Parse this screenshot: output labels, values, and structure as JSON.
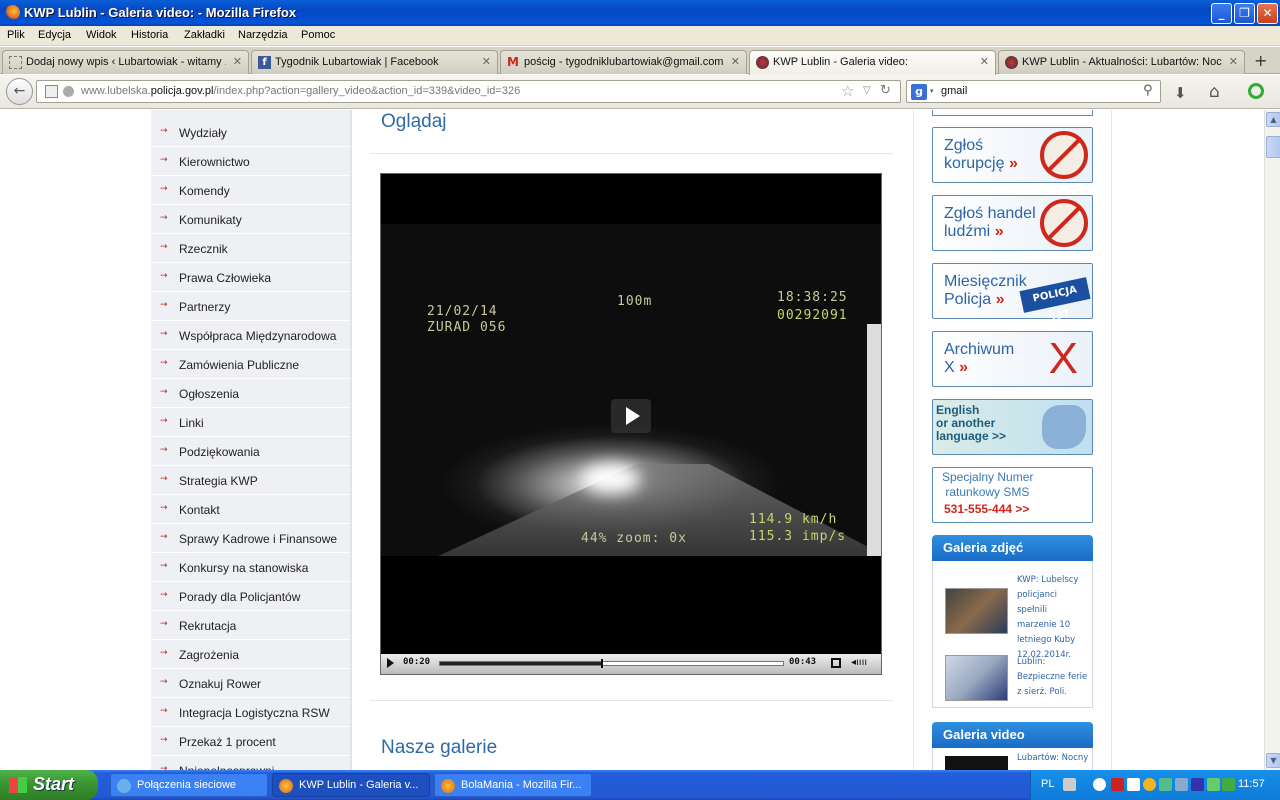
{
  "window": {
    "title": "KWP Lublin - Galeria video: - Mozilla Firefox"
  },
  "menu": [
    "Plik",
    "Edycja",
    "Widok",
    "Historia",
    "Zakładki",
    "Narzędzia",
    "Pomoc"
  ],
  "tabs": [
    {
      "label": "Dodaj nowy wpis ‹ Lubartowiak - witamy ..."
    },
    {
      "label": "Tygodnik Lubartowiak | Facebook"
    },
    {
      "label": "pościg - tygodniklubartowiak@gmail.com ..."
    },
    {
      "label": "KWP Lublin - Galeria video:"
    },
    {
      "label": "KWP Lublin - Aktualności: Lubartów: Noc..."
    }
  ],
  "address": {
    "prefix": "www.lubelska.",
    "host": "policja.gov.pl",
    "path": "/index.php?action=gallery_video&action_id=339&video_id=326"
  },
  "search": {
    "query": "gmail",
    "engine_icon": "google-icon"
  },
  "sidebar": {
    "items": [
      "Wydziały",
      "Kierownictwo",
      "Komendy",
      "Komunikaty",
      "Rzecznik",
      "Prawa Człowieka",
      "Partnerzy",
      "Współpraca Międzynarodowa",
      "Zamówienia Publiczne",
      "Ogłoszenia",
      "Linki",
      "Podziękowania",
      "Strategia KWP",
      "Kontakt",
      "Sprawy Kadrowe i Finansowe",
      "Konkursy na stanowiska",
      "Porady dla Policjantów",
      "Rekrutacja",
      "Zagrożenia",
      "Oznakuj Rower",
      "Integracja Logistyczna RSW",
      "Przekaż 1 procent",
      "Nniepełnosprawni..."
    ]
  },
  "main": {
    "heading": "Oglądaj",
    "video_osd": {
      "date": "21/02/14",
      "unit": "ZURAD 056",
      "distance": "100m",
      "time": "18:38:25",
      "counter": "00292091",
      "zoom": "44%  zoom: 0x",
      "speed": "114.9 km/h",
      "speed2": "115.3 imp/s"
    },
    "player": {
      "current": "00:20",
      "duration": "00:43",
      "progress": 0.47
    },
    "section2": "Nasze galerie"
  },
  "right": {
    "banners": [
      {
        "line1": "Zgłoś",
        "line2": "korupcję",
        "arrow": "»"
      },
      {
        "line1": "Zgłoś handel",
        "line2": "ludźmi",
        "arrow": "»"
      },
      {
        "line1": "Miesięcznik",
        "line2": "Policja",
        "arrow": "»",
        "badge": "POLICJA 997"
      },
      {
        "line1": "Archiwum",
        "line2": "X",
        "arrow": "»"
      }
    ],
    "english": {
      "line1": "English",
      "line2": "or another",
      "line3": "language >>"
    },
    "sms": {
      "line1": "Specjalny Numer",
      "line2": "ratunkowy SMS",
      "number": "531-555-444  >>"
    },
    "gallery_title": "Galeria zdjęć",
    "gallery": [
      {
        "text": "KWP: Lubelscy policjanci spełnili marzenie 10 letniego Kuby 12.02.2014r."
      },
      {
        "text": "Lublin: Bezpieczne ferie z sierż. Poli."
      }
    ],
    "video_title": "Galeria video",
    "video_first": "Lubartów: Nocny"
  },
  "taskbar": {
    "start": "Start",
    "tasks": [
      {
        "label": "Połączenia sieciowe"
      },
      {
        "label": "KWP Lublin - Galeria v..."
      },
      {
        "label": "BolaMania - Mozilla Fir..."
      }
    ],
    "lang": "PL",
    "clock": "11:57"
  }
}
